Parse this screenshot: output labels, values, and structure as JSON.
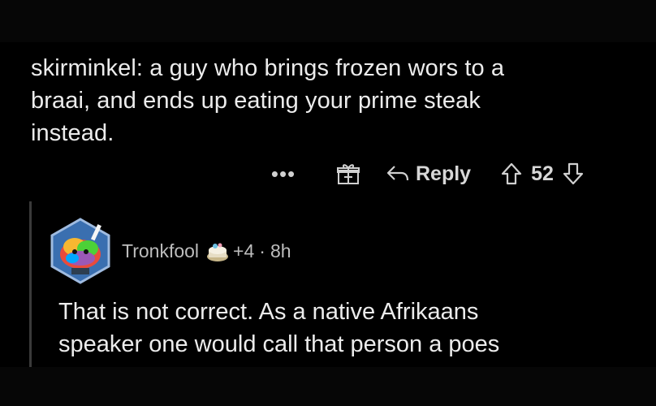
{
  "parent_comment": {
    "body_lines": [
      "skirminkel: a guy who brings frozen wors to a",
      "braai, and ends up eating your prime steak",
      "instead."
    ],
    "actions": {
      "more_label": "•••",
      "reply_label": "Reply",
      "score": "52"
    },
    "icons": [
      "more-icon",
      "award-icon",
      "reply-icon",
      "upvote-icon",
      "downvote-icon"
    ]
  },
  "reply_comment": {
    "username": "Tronkfool",
    "karma": "+4",
    "separator": "·",
    "age": "8h",
    "body_lines": [
      "That is not correct. As a native Afrikaans",
      "speaker one would call that person a poes"
    ],
    "icons": [
      "avatar",
      "cake-flair-icon"
    ]
  },
  "colors": {
    "background": "#000000",
    "text": "#ececec",
    "muted": "#bdbdbd"
  }
}
